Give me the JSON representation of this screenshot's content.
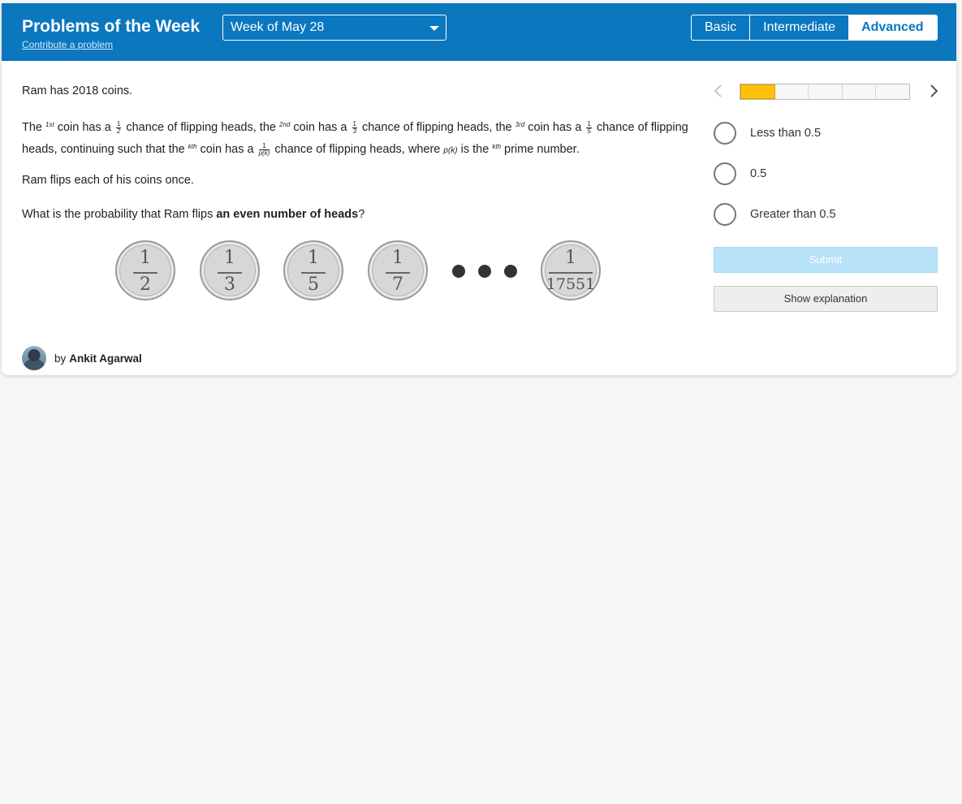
{
  "header": {
    "title": "Problems of the Week",
    "contribute_link": "Contribute a problem",
    "week_select": {
      "selected": "Week of May 28"
    },
    "levels": [
      "Basic",
      "Intermediate",
      "Advanced"
    ],
    "active_level": "Advanced"
  },
  "problem": {
    "intro": "Ram has 2018 coins.",
    "text2": {
      "a": "The ",
      "sup1": "1st",
      "b": " coin has a ",
      "f1n": "1",
      "f1d": "2",
      "c": " chance of flipping heads, the ",
      "sup2": "2nd",
      "d": " coin has a ",
      "f2n": "1",
      "f2d": "3",
      "e": " chance of flipping heads, the ",
      "sup3": "3rd",
      "f": " coin has a ",
      "f3n": "1",
      "f3d": "5",
      "g": " chance of flipping heads, continuing such that the ",
      "sup4": "kth",
      "h": " coin has a ",
      "f4n": "1",
      "f4d": "p(k)",
      "i": " chance of flipping heads, where ",
      "pk": "p(k)",
      "j": " is the ",
      "sup5": "kth",
      "k": " prime number."
    },
    "flips": "Ram flips each of his coins once.",
    "question_start": "What is the probability that Ram flips ",
    "question_bold": "an even number of heads",
    "question_end": "?"
  },
  "coins": [
    {
      "numerator": "1",
      "denominator": "2"
    },
    {
      "numerator": "1",
      "denominator": "3"
    },
    {
      "numerator": "1",
      "denominator": "5"
    },
    {
      "numerator": "1",
      "denominator": "7"
    },
    {
      "numerator": "1",
      "denominator": "17551"
    }
  ],
  "author": {
    "by": "by",
    "name": "Ankit Agarwal"
  },
  "progress": {
    "completed": 1,
    "total": 5,
    "fill_color": "#ffc107"
  },
  "options": [
    "Less than 0.5",
    "0.5",
    "Greater than 0.5"
  ],
  "buttons": {
    "submit": "Submit",
    "explain": "Show explanation"
  },
  "colors": {
    "header": "#0a77bf",
    "progress": "#ffc107",
    "submit": "#b8e2f8"
  }
}
